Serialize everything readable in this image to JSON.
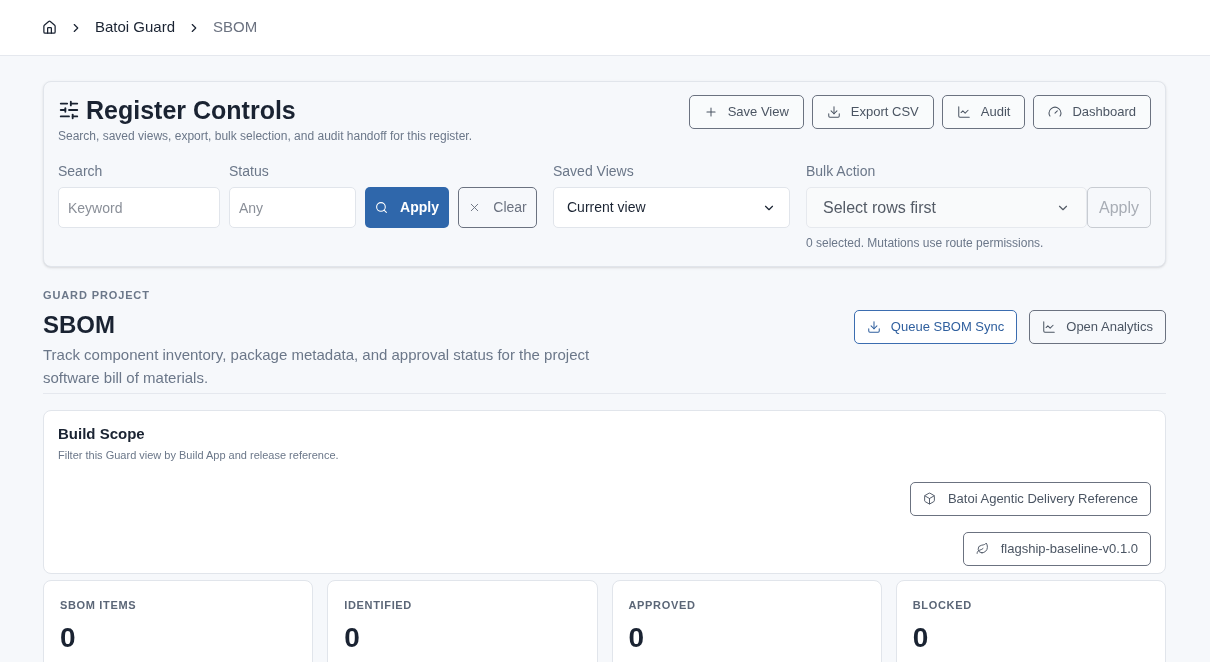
{
  "breadcrumb": [
    {
      "label": "Batoi Guard",
      "current": false
    },
    {
      "label": "SBOM",
      "current": true
    }
  ],
  "register": {
    "title": "Register Controls",
    "subtitle": "Search, saved views, export, bulk selection, and audit handoff for this register.",
    "actions": [
      {
        "label": "Save View",
        "kind": "add"
      },
      {
        "label": "Export CSV",
        "kind": "download"
      },
      {
        "label": "Audit",
        "kind": "chart"
      },
      {
        "label": "Dashboard",
        "kind": "gauge"
      }
    ],
    "search": {
      "label": "Search",
      "placeholder": "Keyword"
    },
    "status": {
      "label": "Status",
      "placeholder": "Any"
    },
    "apply": {
      "label": "Apply"
    },
    "clear": {
      "label": "Clear"
    },
    "saved_views": {
      "label": "Saved Views",
      "value": "Current view"
    },
    "bulk": {
      "label": "Bulk Action",
      "value": "Select rows first",
      "apply": "Apply",
      "disabled": true,
      "note": "0 selected. Mutations use route permissions."
    }
  },
  "project": {
    "eyebrow": "GUARD PROJECT",
    "title": "SBOM",
    "description": "Track component inventory, package metadata, and approval status for the project software bill of materials.",
    "actions": [
      {
        "label": "Queue SBOM Sync",
        "kind": "download",
        "primary": true
      },
      {
        "label": "Open Analytics",
        "kind": "chart",
        "primary": false
      }
    ]
  },
  "build_scope": {
    "title": "Build Scope",
    "subtitle": "Filter this Guard view by Build App and release reference.",
    "chips": [
      {
        "label": "Batoi Agentic Delivery Reference",
        "kind": "app"
      },
      {
        "label": "flagship-baseline-v0.1.0",
        "kind": "release"
      }
    ]
  },
  "stats": [
    {
      "label": "SBOM ITEMS",
      "value": "0"
    },
    {
      "label": "IDENTIFIED",
      "value": "0"
    },
    {
      "label": "APPROVED",
      "value": "0"
    },
    {
      "label": "BLOCKED",
      "value": "0"
    }
  ]
}
